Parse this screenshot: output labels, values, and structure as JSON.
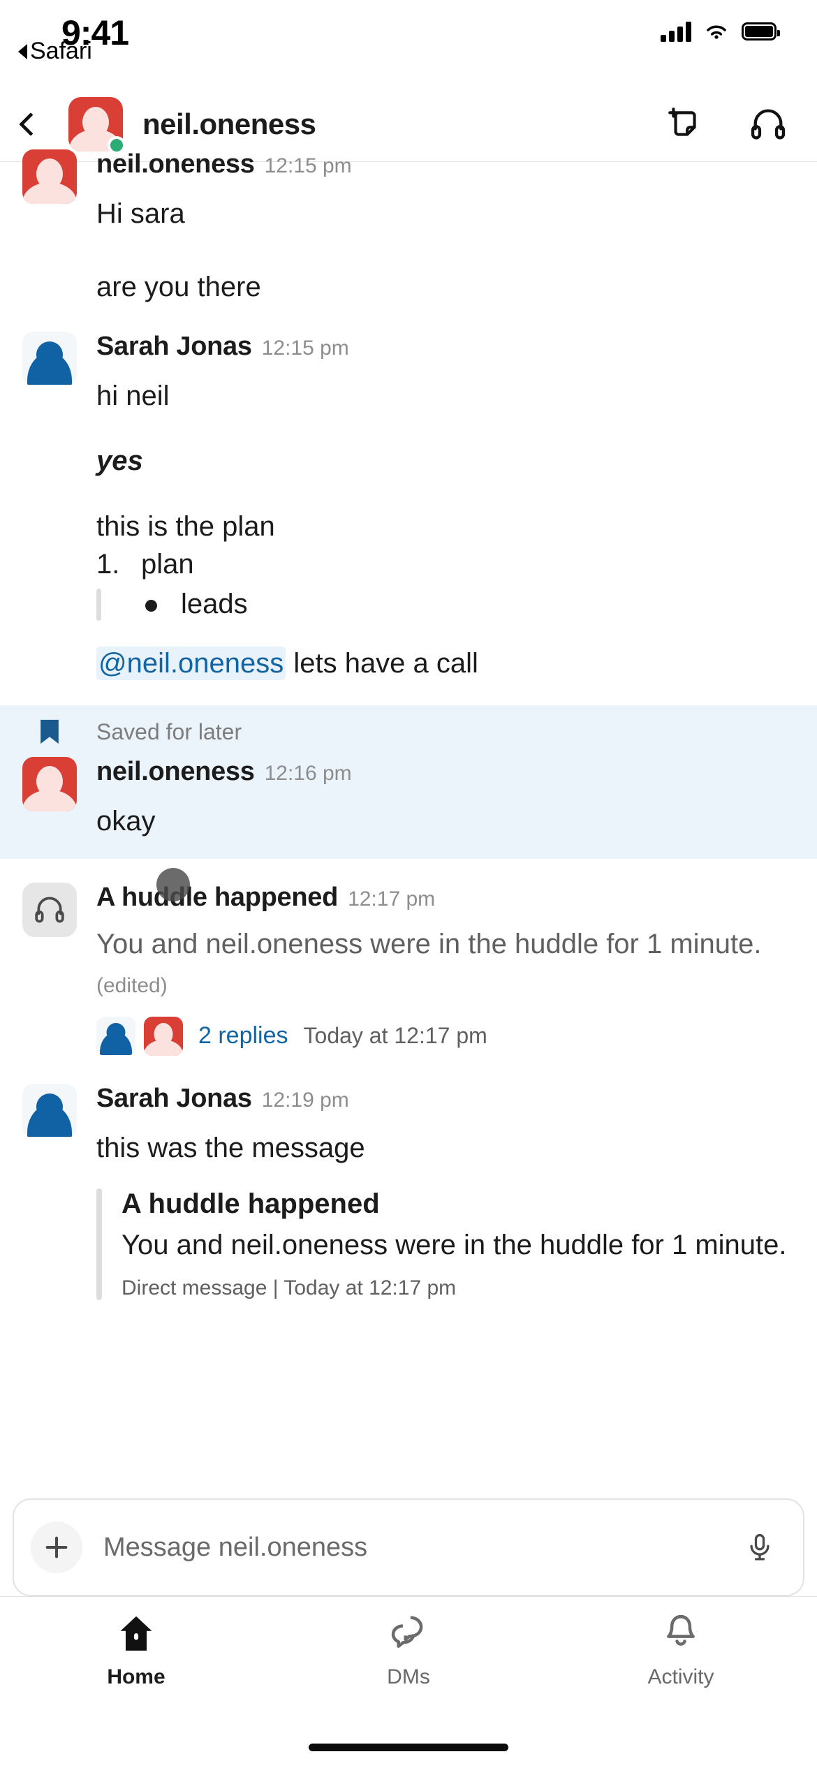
{
  "status_bar": {
    "time": "9:41",
    "back_app_label": "Safari",
    "signal_icon": "cellular-signal-icon",
    "wifi_icon": "wifi-icon",
    "battery_icon": "battery-icon"
  },
  "nav": {
    "back_icon": "chevron-left-icon",
    "avatar_icon": "user-avatar",
    "presence": "online",
    "title": "neil.oneness",
    "actions": [
      {
        "name": "new-canvas-button",
        "icon": "document-plus-icon"
      },
      {
        "name": "huddle-button",
        "icon": "headphones-icon"
      }
    ]
  },
  "messages": [
    {
      "id": "m1",
      "author": "neil.oneness",
      "timestamp": "12:15 pm",
      "avatar": "red",
      "clipped_top": true,
      "lines": [
        "Hi sara",
        "are you there"
      ]
    },
    {
      "id": "m2",
      "author": "Sarah Jonas",
      "timestamp": "12:15 pm",
      "avatar": "blue",
      "lines": [
        "hi neil"
      ],
      "emphasis_line": "yes",
      "plan_intro": "this is the plan",
      "ordered_item_number": "1.",
      "ordered_item_text": "plan",
      "bullet_item_text": "leads",
      "mention": "@neil.oneness",
      "mention_rest": " lets have a call"
    },
    {
      "id": "m3",
      "saved_banner": "Saved for later",
      "saved_icon": "bookmark-icon",
      "author": "neil.oneness",
      "timestamp": "12:16 pm",
      "avatar": "red",
      "lines": [
        "okay"
      ]
    },
    {
      "id": "m4",
      "author": "A huddle happened",
      "timestamp": "12:17 pm",
      "avatar": "huddle",
      "body": "You and neil.oneness were in the huddle for 1 minute.",
      "edited_label": "(edited)",
      "replies_link": "2 replies",
      "replies_timestamp": "Today at 12:17 pm"
    },
    {
      "id": "m5",
      "author": "Sarah Jonas",
      "timestamp": "12:19 pm",
      "avatar": "blue",
      "lines": [
        "this was the message"
      ],
      "quote": {
        "title": "A huddle happened",
        "text": "You and neil.oneness were in the huddle for 1 minute.",
        "meta": "Direct message | Today at 12:17 pm"
      }
    }
  ],
  "composer": {
    "plus_icon": "plus-icon",
    "placeholder": "Message neil.oneness",
    "value": "",
    "mic_icon": "microphone-icon"
  },
  "tabbar": [
    {
      "label": "Home",
      "icon": "home-icon",
      "active": true
    },
    {
      "label": "DMs",
      "icon": "dms-icon",
      "active": false
    },
    {
      "label": "Activity",
      "icon": "bell-icon",
      "active": false
    }
  ],
  "colors": {
    "slack_blue_link": "#1264a3",
    "avatar_red": "#d93f35",
    "avatar_blue": "#1161a5",
    "presence_green": "#2bac76",
    "saved_highlight": "#eaf4fa",
    "mention_bg": "#e8f2fb"
  }
}
